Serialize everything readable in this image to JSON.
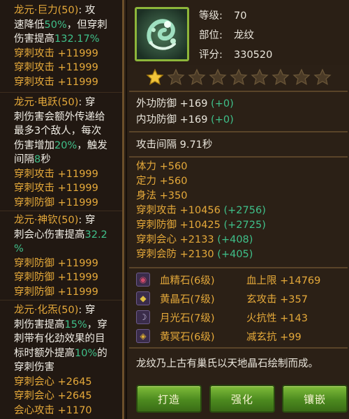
{
  "skills": [
    {
      "lines": [
        {
          "parts": [
            {
              "t": "龙元·巨力(50)",
              "c": "nm"
            },
            {
              "t": ": 攻"
            }
          ]
        },
        {
          "parts": [
            {
              "t": "速降低"
            },
            {
              "t": "50%",
              "c": "pct"
            },
            {
              "t": "，但穿刺"
            }
          ]
        },
        {
          "parts": [
            {
              "t": "伤害提高"
            },
            {
              "t": "132.17%",
              "c": "pct"
            }
          ]
        }
      ],
      "stats": [
        "穿刺攻击 +11999",
        "穿刺攻击 +11999",
        "穿刺攻击 +11999"
      ]
    },
    {
      "lines": [
        {
          "parts": [
            {
              "t": "龙元·电跃(50)",
              "c": "nm"
            },
            {
              "t": ": 穿"
            }
          ]
        },
        {
          "parts": [
            {
              "t": "刺伤害会额外传递给"
            }
          ]
        },
        {
          "parts": [
            {
              "t": "最多3个敌人，每次"
            }
          ]
        },
        {
          "parts": [
            {
              "t": "伤害增加"
            },
            {
              "t": "20%",
              "c": "pct"
            },
            {
              "t": "，触发"
            }
          ]
        },
        {
          "parts": [
            {
              "t": "间隔"
            },
            {
              "t": "8",
              "c": "pct"
            },
            {
              "t": "秒"
            }
          ]
        }
      ],
      "stats": [
        "穿刺攻击 +11999",
        "穿刺攻击 +11999",
        "穿刺防御 +11999"
      ]
    },
    {
      "lines": [
        {
          "parts": [
            {
              "t": "龙元·神钦(50)",
              "c": "nm"
            },
            {
              "t": ": 穿"
            }
          ]
        },
        {
          "parts": [
            {
              "t": "刺会心伤害提高"
            },
            {
              "t": "32.2",
              "c": "pct"
            }
          ]
        },
        {
          "parts": [
            {
              "t": "%",
              "c": "pct"
            }
          ]
        }
      ],
      "stats": [
        "穿刺防御 +11999",
        "穿刺防御 +11999",
        "穿刺防御 +11999"
      ]
    },
    {
      "lines": [
        {
          "parts": [
            {
              "t": "龙元·化炁(50)",
              "c": "nm"
            },
            {
              "t": ": 穿"
            }
          ]
        },
        {
          "parts": [
            {
              "t": "刺伤害提高"
            },
            {
              "t": "15%",
              "c": "pct"
            },
            {
              "t": "，穿"
            }
          ]
        },
        {
          "parts": [
            {
              "t": "刺带有化劲效果的目"
            }
          ]
        },
        {
          "parts": [
            {
              "t": "标时额外提高"
            },
            {
              "t": "10%",
              "c": "pct"
            },
            {
              "t": "的"
            }
          ]
        },
        {
          "parts": [
            {
              "t": "穿刺伤害"
            }
          ]
        }
      ],
      "stats": [
        "穿刺会心 +2645",
        "穿刺会心 +2645",
        "会心攻击 +1170"
      ]
    }
  ],
  "item": {
    "level_label": "等级:",
    "level": "70",
    "slot_label": "部位:",
    "slot": "龙纹",
    "score_label": "评分:",
    "score": "330520",
    "stars_filled": 1,
    "stars_total": 9
  },
  "defense": [
    {
      "label": "外功防御 +169",
      "bonus": "(+0)"
    },
    {
      "label": "内功防御 +169",
      "bonus": "(+0)"
    }
  ],
  "attack_interval": "攻击间隔 9.71秒",
  "attrs": [
    {
      "label": "体力 +560",
      "bonus": ""
    },
    {
      "label": "定力 +560",
      "bonus": ""
    },
    {
      "label": "身法 +350",
      "bonus": ""
    },
    {
      "label": "穿刺攻击 +10456",
      "bonus": "(+2756)"
    },
    {
      "label": "穿刺防御 +10425",
      "bonus": "(+2725)"
    },
    {
      "label": "穿刺会心 +2133",
      "bonus": "(+408)"
    },
    {
      "label": "穿刺会防 +2130",
      "bonus": "(+405)"
    }
  ],
  "gems": [
    {
      "name": "血精石(6级)",
      "stat": "血上限 +14769",
      "icon": "blood-gem-icon",
      "color": "#d04a6a"
    },
    {
      "name": "黄晶石(7级)",
      "stat": "玄攻击 +357",
      "icon": "yellow-crystal-icon",
      "color": "#e0c040"
    },
    {
      "name": "月光石(7级)",
      "stat": "火抗性 +143",
      "icon": "moonstone-icon",
      "color": "#c8c0e0"
    },
    {
      "name": "黄冥石(6级)",
      "stat": "减玄抗 +99",
      "icon": "yellow-nether-gem-icon",
      "color": "#e0b030"
    }
  ],
  "description": "龙纹乃上古有巢氏以天地晶石绘制而成。",
  "buttons": {
    "forge": "打造",
    "enhance": "强化",
    "inlay": "镶嵌"
  }
}
